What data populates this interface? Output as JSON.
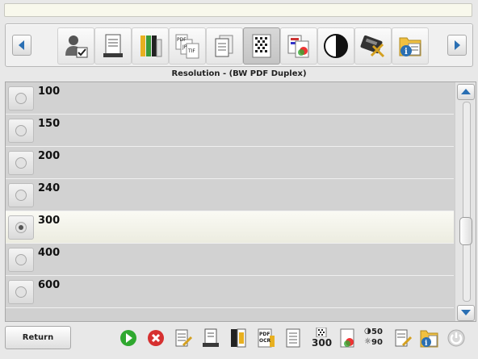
{
  "title": "Resolution - (BW PDF Duplex)",
  "status_text": "",
  "toolbar": {
    "nav_left": "prev-icon",
    "nav_right": "next-icon",
    "icons": [
      "user-check-icon",
      "document-icon",
      "color-pages-icon",
      "file-format-icon",
      "multi-page-icon",
      "resolution-icon",
      "color-dropout-icon",
      "contrast-icon",
      "scanner-tools-icon",
      "info-folder-icon"
    ],
    "format_labels": [
      "PDF",
      "JP",
      "TIF"
    ],
    "active_icon": "resolution-icon"
  },
  "options": [
    {
      "label": "100",
      "selected": false
    },
    {
      "label": "150",
      "selected": false
    },
    {
      "label": "200",
      "selected": false
    },
    {
      "label": "240",
      "selected": false
    },
    {
      "label": "300",
      "selected": true
    },
    {
      "label": "400",
      "selected": false
    },
    {
      "label": "600",
      "selected": false
    }
  ],
  "scrollbar": {
    "position_fraction": 0.65
  },
  "bottom": {
    "return_label": "Return",
    "resolution_value": "300",
    "pdf_label": "PDF",
    "ocr_label": "OCR",
    "brightness_value": "50",
    "contrast_value": "90",
    "brightness_symbol": "◑",
    "contrast_symbol": "☼"
  },
  "colors": {
    "selected_row": "#f6f6ee",
    "accent_blue": "#2a6fb3",
    "start_green": "#2fa82f",
    "stop_red": "#d63030"
  }
}
